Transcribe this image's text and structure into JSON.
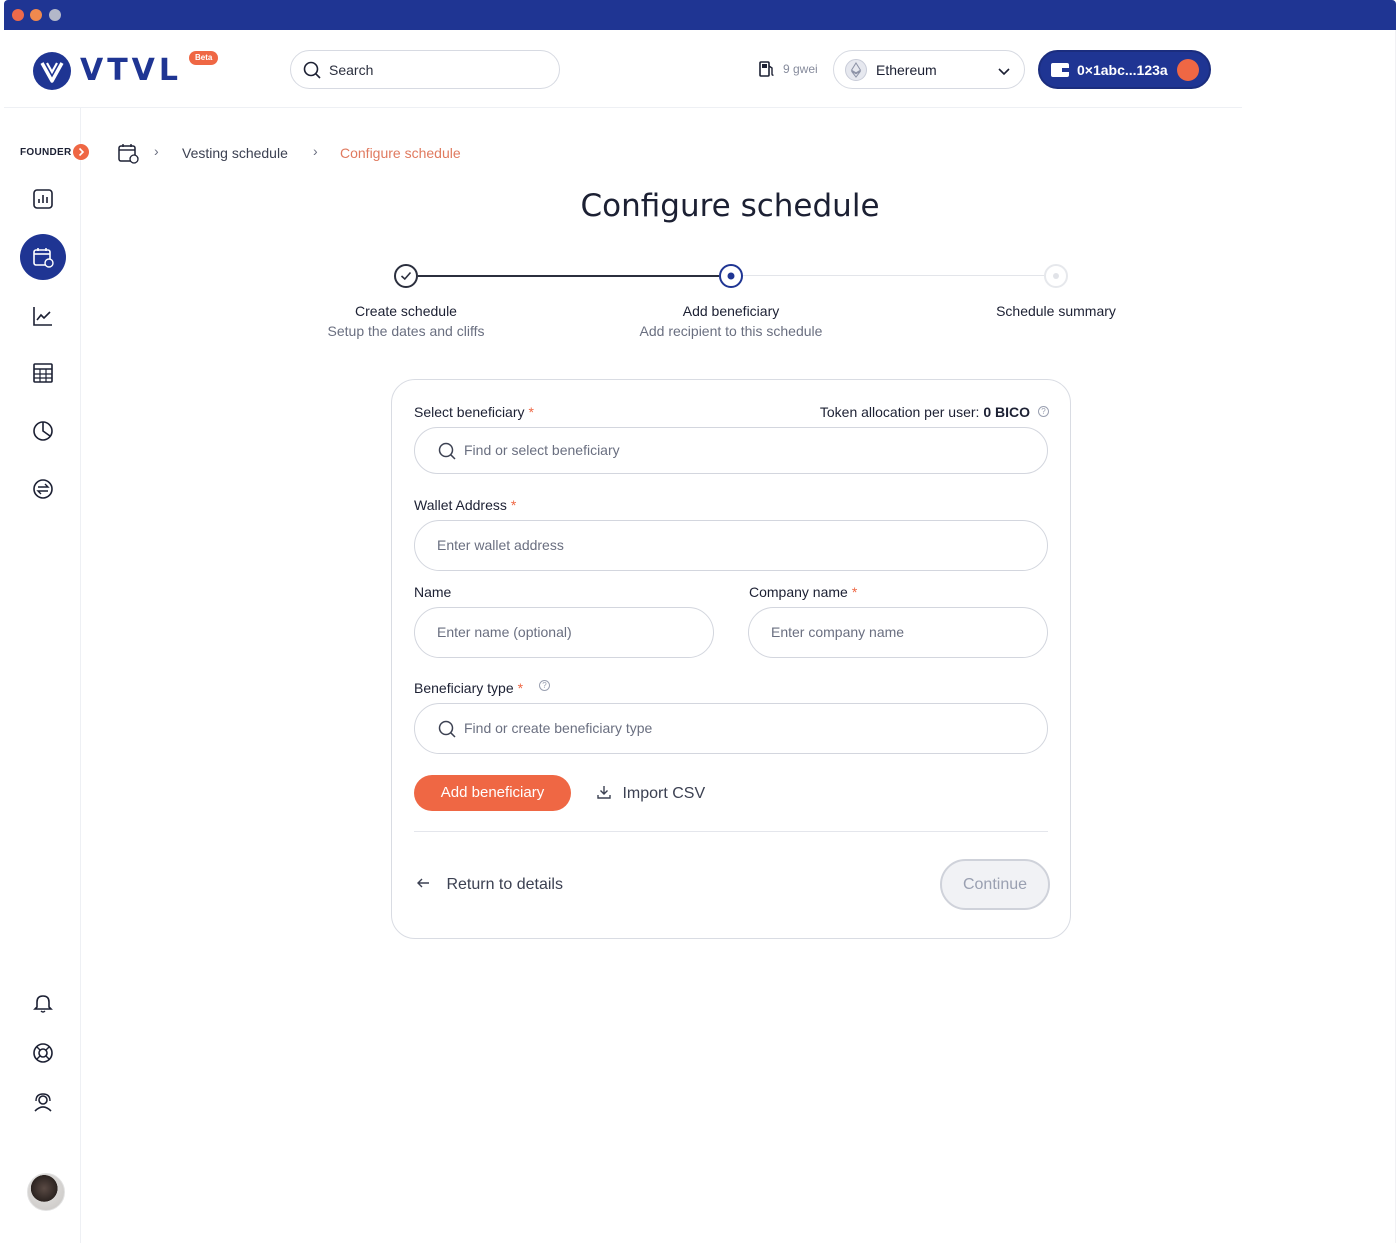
{
  "app": {
    "brand": "VTVL",
    "beta_badge": "Beta"
  },
  "header": {
    "search_placeholder": "Search",
    "gas": "9 gwei",
    "network": "Ethereum",
    "wallet_address": "0×1abc...123a"
  },
  "sidebar": {
    "role_label": "FOUNDER",
    "items": [
      {
        "icon": "bar-chart-icon"
      },
      {
        "icon": "calendar-icon",
        "active": true
      },
      {
        "icon": "line-chart-icon"
      },
      {
        "icon": "table-icon"
      },
      {
        "icon": "pie-chart-icon"
      },
      {
        "icon": "swap-icon"
      }
    ],
    "bottom_items": [
      {
        "icon": "bell-icon"
      },
      {
        "icon": "lifebuoy-icon"
      },
      {
        "icon": "support-icon"
      }
    ]
  },
  "breadcrumb": {
    "items": [
      "Vesting schedule",
      "Configure schedule"
    ]
  },
  "page": {
    "title": "Configure schedule"
  },
  "stepper": {
    "steps": [
      {
        "title": "Create schedule",
        "subtitle": "Setup the dates and cliffs",
        "state": "done"
      },
      {
        "title": "Add beneficiary",
        "subtitle": "Add recipient to this schedule",
        "state": "current"
      },
      {
        "title": "Schedule summary",
        "subtitle": "",
        "state": "pending"
      }
    ]
  },
  "form": {
    "beneficiary_label": "Select beneficiary",
    "allocation_label": "Token allocation per user:",
    "allocation_value": "0 BICO",
    "beneficiary_placeholder": "Find or select beneficiary",
    "wallet_label": "Wallet Address",
    "wallet_placeholder": "Enter wallet address",
    "name_label": "Name",
    "name_placeholder": "Enter name (optional)",
    "company_label": "Company name",
    "company_placeholder": "Enter company name",
    "type_label": "Beneficiary type",
    "type_placeholder": "Find or create beneficiary type",
    "required_mark": "*",
    "help_mark": "?",
    "add_button": "Add beneficiary",
    "import_button": "Import CSV",
    "return_link": "Return to details",
    "continue_button": "Continue"
  },
  "colors": {
    "brand": "#1f3593",
    "accent": "#ef6744",
    "breadcrumb_current": "#e07a5f"
  }
}
